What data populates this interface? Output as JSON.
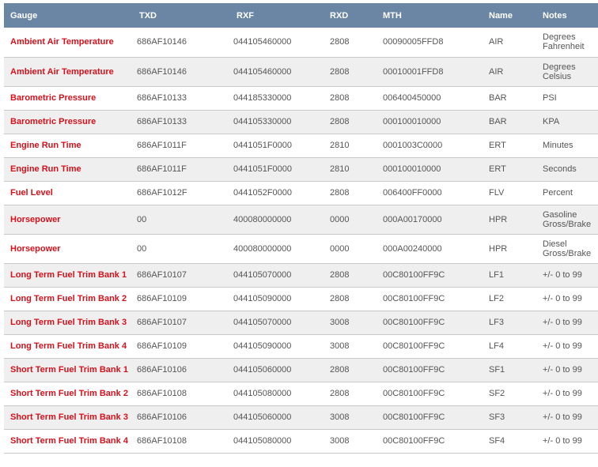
{
  "table": {
    "headers": {
      "gauge": "Gauge",
      "txd": "TXD",
      "rxf": "RXF",
      "rxd": "RXD",
      "mth": "MTH",
      "name": "Name",
      "notes": "Notes"
    },
    "rows": [
      {
        "gauge": "Ambient Air Temperature",
        "txd": "686AF10146",
        "rxf": "044105460000",
        "rxd": "2808",
        "mth": "00090005FFD8",
        "name": "AIR",
        "notes": [
          "Degrees",
          "Fahrenheit"
        ]
      },
      {
        "gauge": "Ambient Air Temperature",
        "txd": "686AF10146",
        "rxf": "044105460000",
        "rxd": "2808",
        "mth": "00010001FFD8",
        "name": "AIR",
        "notes": [
          "Degrees",
          "Celsius"
        ]
      },
      {
        "gauge": "Barometric Pressure",
        "txd": "686AF10133",
        "rxf": "044185330000",
        "rxd": "2808",
        "mth": "006400450000",
        "name": "BAR",
        "notes": [
          "PSI"
        ]
      },
      {
        "gauge": "Barometric Pressure",
        "txd": "686AF10133",
        "rxf": "044105330000",
        "rxd": "2808",
        "mth": "000100010000",
        "name": "BAR",
        "notes": [
          "KPA"
        ]
      },
      {
        "gauge": "Engine Run Time",
        "txd": "686AF1011F",
        "rxf": "0441051F0000",
        "rxd": "2810",
        "mth": "0001003C0000",
        "name": "ERT",
        "notes": [
          "Minutes"
        ]
      },
      {
        "gauge": "Engine Run Time",
        "txd": "686AF1011F",
        "rxf": "0441051F0000",
        "rxd": "2810",
        "mth": "000100010000",
        "name": "ERT",
        "notes": [
          "Seconds"
        ]
      },
      {
        "gauge": "Fuel Level",
        "txd": "686AF1012F",
        "rxf": "0441052F0000",
        "rxd": "2808",
        "mth": "006400FF0000",
        "name": "FLV",
        "notes": [
          "Percent"
        ]
      },
      {
        "gauge": "Horsepower",
        "txd": "00",
        "rxf": "400080000000",
        "rxd": "0000",
        "mth": "000A00170000",
        "name": "HPR",
        "notes": [
          "Gasoline",
          "Gross/Brake"
        ]
      },
      {
        "gauge": "Horsepower",
        "txd": "00",
        "rxf": "400080000000",
        "rxd": "0000",
        "mth": "000A00240000",
        "name": "HPR",
        "notes": [
          "Diesel",
          "Gross/Brake"
        ]
      },
      {
        "gauge": "Long Term Fuel Trim Bank 1",
        "txd": "686AF10107",
        "rxf": "044105070000",
        "rxd": "2808",
        "mth": "00C80100FF9C",
        "name": "LF1",
        "notes": [
          "+/- 0 to 99"
        ]
      },
      {
        "gauge": "Long Term Fuel Trim Bank 2",
        "txd": "686AF10109",
        "rxf": "044105090000",
        "rxd": "2808",
        "mth": "00C80100FF9C",
        "name": "LF2",
        "notes": [
          "+/- 0 to 99"
        ]
      },
      {
        "gauge": "Long Term Fuel Trim Bank 3",
        "txd": "686AF10107",
        "rxf": "044105070000",
        "rxd": "3008",
        "mth": "00C80100FF9C",
        "name": "LF3",
        "notes": [
          "+/- 0 to 99"
        ]
      },
      {
        "gauge": "Long Term Fuel Trim Bank 4",
        "txd": "686AF10109",
        "rxf": "044105090000",
        "rxd": "3008",
        "mth": "00C80100FF9C",
        "name": "LF4",
        "notes": [
          "+/- 0 to 99"
        ]
      },
      {
        "gauge": "Short Term Fuel Trim Bank 1",
        "txd": "686AF10106",
        "rxf": "044105060000",
        "rxd": "2808",
        "mth": "00C80100FF9C",
        "name": "SF1",
        "notes": [
          "+/- 0 to 99"
        ]
      },
      {
        "gauge": "Short Term Fuel Trim Bank 2",
        "txd": "686AF10108",
        "rxf": "044105080000",
        "rxd": "2808",
        "mth": "00C80100FF9C",
        "name": "SF2",
        "notes": [
          "+/- 0 to 99"
        ]
      },
      {
        "gauge": "Short Term Fuel Trim Bank 3",
        "txd": "686AF10106",
        "rxf": "044105060000",
        "rxd": "3008",
        "mth": "00C80100FF9C",
        "name": "SF3",
        "notes": [
          "+/- 0 to 99"
        ]
      },
      {
        "gauge": "Short Term Fuel Trim Bank 4",
        "txd": "686AF10108",
        "rxf": "044105080000",
        "rxd": "3008",
        "mth": "00C80100FF9C",
        "name": "SF4",
        "notes": [
          "+/- 0 to 99"
        ]
      }
    ]
  },
  "colors": {
    "header_bg": "#6b86a5",
    "header_text": "#ffffff",
    "gauge_text": "#d6111b",
    "cell_text": "#555555",
    "row_alt_bg": "#efefef",
    "row_border": "#c9c9c9"
  }
}
